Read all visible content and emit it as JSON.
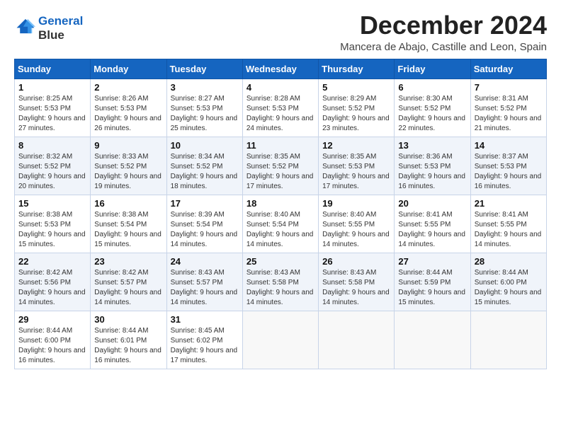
{
  "logo": {
    "line1": "General",
    "line2": "Blue"
  },
  "title": "December 2024",
  "subtitle": "Mancera de Abajo, Castille and Leon, Spain",
  "days_of_week": [
    "Sunday",
    "Monday",
    "Tuesday",
    "Wednesday",
    "Thursday",
    "Friday",
    "Saturday"
  ],
  "weeks": [
    [
      {
        "day": "1",
        "sunrise": "Sunrise: 8:25 AM",
        "sunset": "Sunset: 5:53 PM",
        "daylight": "Daylight: 9 hours and 27 minutes."
      },
      {
        "day": "2",
        "sunrise": "Sunrise: 8:26 AM",
        "sunset": "Sunset: 5:53 PM",
        "daylight": "Daylight: 9 hours and 26 minutes."
      },
      {
        "day": "3",
        "sunrise": "Sunrise: 8:27 AM",
        "sunset": "Sunset: 5:53 PM",
        "daylight": "Daylight: 9 hours and 25 minutes."
      },
      {
        "day": "4",
        "sunrise": "Sunrise: 8:28 AM",
        "sunset": "Sunset: 5:53 PM",
        "daylight": "Daylight: 9 hours and 24 minutes."
      },
      {
        "day": "5",
        "sunrise": "Sunrise: 8:29 AM",
        "sunset": "Sunset: 5:52 PM",
        "daylight": "Daylight: 9 hours and 23 minutes."
      },
      {
        "day": "6",
        "sunrise": "Sunrise: 8:30 AM",
        "sunset": "Sunset: 5:52 PM",
        "daylight": "Daylight: 9 hours and 22 minutes."
      },
      {
        "day": "7",
        "sunrise": "Sunrise: 8:31 AM",
        "sunset": "Sunset: 5:52 PM",
        "daylight": "Daylight: 9 hours and 21 minutes."
      }
    ],
    [
      {
        "day": "8",
        "sunrise": "Sunrise: 8:32 AM",
        "sunset": "Sunset: 5:52 PM",
        "daylight": "Daylight: 9 hours and 20 minutes."
      },
      {
        "day": "9",
        "sunrise": "Sunrise: 8:33 AM",
        "sunset": "Sunset: 5:52 PM",
        "daylight": "Daylight: 9 hours and 19 minutes."
      },
      {
        "day": "10",
        "sunrise": "Sunrise: 8:34 AM",
        "sunset": "Sunset: 5:52 PM",
        "daylight": "Daylight: 9 hours and 18 minutes."
      },
      {
        "day": "11",
        "sunrise": "Sunrise: 8:35 AM",
        "sunset": "Sunset: 5:52 PM",
        "daylight": "Daylight: 9 hours and 17 minutes."
      },
      {
        "day": "12",
        "sunrise": "Sunrise: 8:35 AM",
        "sunset": "Sunset: 5:53 PM",
        "daylight": "Daylight: 9 hours and 17 minutes."
      },
      {
        "day": "13",
        "sunrise": "Sunrise: 8:36 AM",
        "sunset": "Sunset: 5:53 PM",
        "daylight": "Daylight: 9 hours and 16 minutes."
      },
      {
        "day": "14",
        "sunrise": "Sunrise: 8:37 AM",
        "sunset": "Sunset: 5:53 PM",
        "daylight": "Daylight: 9 hours and 16 minutes."
      }
    ],
    [
      {
        "day": "15",
        "sunrise": "Sunrise: 8:38 AM",
        "sunset": "Sunset: 5:53 PM",
        "daylight": "Daylight: 9 hours and 15 minutes."
      },
      {
        "day": "16",
        "sunrise": "Sunrise: 8:38 AM",
        "sunset": "Sunset: 5:54 PM",
        "daylight": "Daylight: 9 hours and 15 minutes."
      },
      {
        "day": "17",
        "sunrise": "Sunrise: 8:39 AM",
        "sunset": "Sunset: 5:54 PM",
        "daylight": "Daylight: 9 hours and 14 minutes."
      },
      {
        "day": "18",
        "sunrise": "Sunrise: 8:40 AM",
        "sunset": "Sunset: 5:54 PM",
        "daylight": "Daylight: 9 hours and 14 minutes."
      },
      {
        "day": "19",
        "sunrise": "Sunrise: 8:40 AM",
        "sunset": "Sunset: 5:55 PM",
        "daylight": "Daylight: 9 hours and 14 minutes."
      },
      {
        "day": "20",
        "sunrise": "Sunrise: 8:41 AM",
        "sunset": "Sunset: 5:55 PM",
        "daylight": "Daylight: 9 hours and 14 minutes."
      },
      {
        "day": "21",
        "sunrise": "Sunrise: 8:41 AM",
        "sunset": "Sunset: 5:55 PM",
        "daylight": "Daylight: 9 hours and 14 minutes."
      }
    ],
    [
      {
        "day": "22",
        "sunrise": "Sunrise: 8:42 AM",
        "sunset": "Sunset: 5:56 PM",
        "daylight": "Daylight: 9 hours and 14 minutes."
      },
      {
        "day": "23",
        "sunrise": "Sunrise: 8:42 AM",
        "sunset": "Sunset: 5:57 PM",
        "daylight": "Daylight: 9 hours and 14 minutes."
      },
      {
        "day": "24",
        "sunrise": "Sunrise: 8:43 AM",
        "sunset": "Sunset: 5:57 PM",
        "daylight": "Daylight: 9 hours and 14 minutes."
      },
      {
        "day": "25",
        "sunrise": "Sunrise: 8:43 AM",
        "sunset": "Sunset: 5:58 PM",
        "daylight": "Daylight: 9 hours and 14 minutes."
      },
      {
        "day": "26",
        "sunrise": "Sunrise: 8:43 AM",
        "sunset": "Sunset: 5:58 PM",
        "daylight": "Daylight: 9 hours and 14 minutes."
      },
      {
        "day": "27",
        "sunrise": "Sunrise: 8:44 AM",
        "sunset": "Sunset: 5:59 PM",
        "daylight": "Daylight: 9 hours and 15 minutes."
      },
      {
        "day": "28",
        "sunrise": "Sunrise: 8:44 AM",
        "sunset": "Sunset: 6:00 PM",
        "daylight": "Daylight: 9 hours and 15 minutes."
      }
    ],
    [
      {
        "day": "29",
        "sunrise": "Sunrise: 8:44 AM",
        "sunset": "Sunset: 6:00 PM",
        "daylight": "Daylight: 9 hours and 16 minutes."
      },
      {
        "day": "30",
        "sunrise": "Sunrise: 8:44 AM",
        "sunset": "Sunset: 6:01 PM",
        "daylight": "Daylight: 9 hours and 16 minutes."
      },
      {
        "day": "31",
        "sunrise": "Sunrise: 8:45 AM",
        "sunset": "Sunset: 6:02 PM",
        "daylight": "Daylight: 9 hours and 17 minutes."
      },
      null,
      null,
      null,
      null
    ]
  ]
}
